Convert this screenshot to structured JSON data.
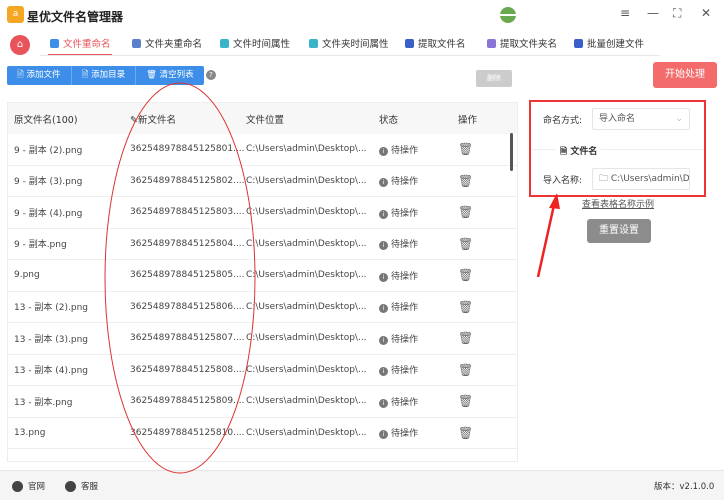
{
  "app": {
    "title": "星优文件名管理器",
    "logo_text": "a"
  },
  "window": {
    "menu_icon": "≡",
    "min": "—",
    "max": "⛶",
    "close": "✕"
  },
  "tabs": [
    {
      "label": "文件重命名",
      "color": "#3d8ee8"
    },
    {
      "label": "文件夹重命名",
      "color": "#5b7fc9"
    },
    {
      "label": "文件时间属性",
      "color": "#39b4c8"
    },
    {
      "label": "文件夹时间属性",
      "color": "#39b4c8"
    },
    {
      "label": "提取文件名",
      "color": "#3a5fc8"
    },
    {
      "label": "提取文件夹名",
      "color": "#8b74d8"
    },
    {
      "label": "批量创建文件",
      "color": "#3a5fc8"
    }
  ],
  "toolbar": {
    "add_file": "添加文件",
    "add_dir": "添加目录",
    "clear": "清空列表",
    "help": "?",
    "delete": "删除",
    "start": "开始处理"
  },
  "table": {
    "headers": [
      "原文件名(100)",
      "新文件名",
      "文件位置",
      "状态",
      "操作"
    ],
    "rows": [
      {
        "orig": "9 - 副本 (2).png",
        "new": "362548978845125801....",
        "loc": "C:\\Users\\admin\\Desktop\\...",
        "status": "待操作"
      },
      {
        "orig": "9 - 副本 (3).png",
        "new": "362548978845125802....",
        "loc": "C:\\Users\\admin\\Desktop\\...",
        "status": "待操作"
      },
      {
        "orig": "9 - 副本 (4).png",
        "new": "362548978845125803....",
        "loc": "C:\\Users\\admin\\Desktop\\...",
        "status": "待操作"
      },
      {
        "orig": "9 - 副本.png",
        "new": "362548978845125804....",
        "loc": "C:\\Users\\admin\\Desktop\\...",
        "status": "待操作"
      },
      {
        "orig": "9.png",
        "new": "362548978845125805....",
        "loc": "C:\\Users\\admin\\Desktop\\...",
        "status": "待操作"
      },
      {
        "orig": "13 - 副本 (2).png",
        "new": "362548978845125806....",
        "loc": "C:\\Users\\admin\\Desktop\\...",
        "status": "待操作"
      },
      {
        "orig": "13 - 副本 (3).png",
        "new": "362548978845125807....",
        "loc": "C:\\Users\\admin\\Desktop\\...",
        "status": "待操作"
      },
      {
        "orig": "13 - 副本 (4).png",
        "new": "362548978845125808....",
        "loc": "C:\\Users\\admin\\Desktop\\...",
        "status": "待操作"
      },
      {
        "orig": "13 - 副本.png",
        "new": "362548978845125809....",
        "loc": "C:\\Users\\admin\\Desktop\\...",
        "status": "待操作"
      },
      {
        "orig": "13.png",
        "new": "362548978845125810....",
        "loc": "C:\\Users\\admin\\Desktop\\...",
        "status": "待操作"
      }
    ]
  },
  "panel": {
    "mode_label": "命名方式:",
    "mode_value": "导入命名",
    "section": "文件名",
    "import_label": "导入名称:",
    "import_value": "C:\\Users\\admin\\Desktop",
    "example_link": "查看表格名称示例",
    "reset": "重置设置"
  },
  "footer": {
    "website": "官网",
    "service": "客服",
    "version": "版本：v2.1.0.0"
  }
}
